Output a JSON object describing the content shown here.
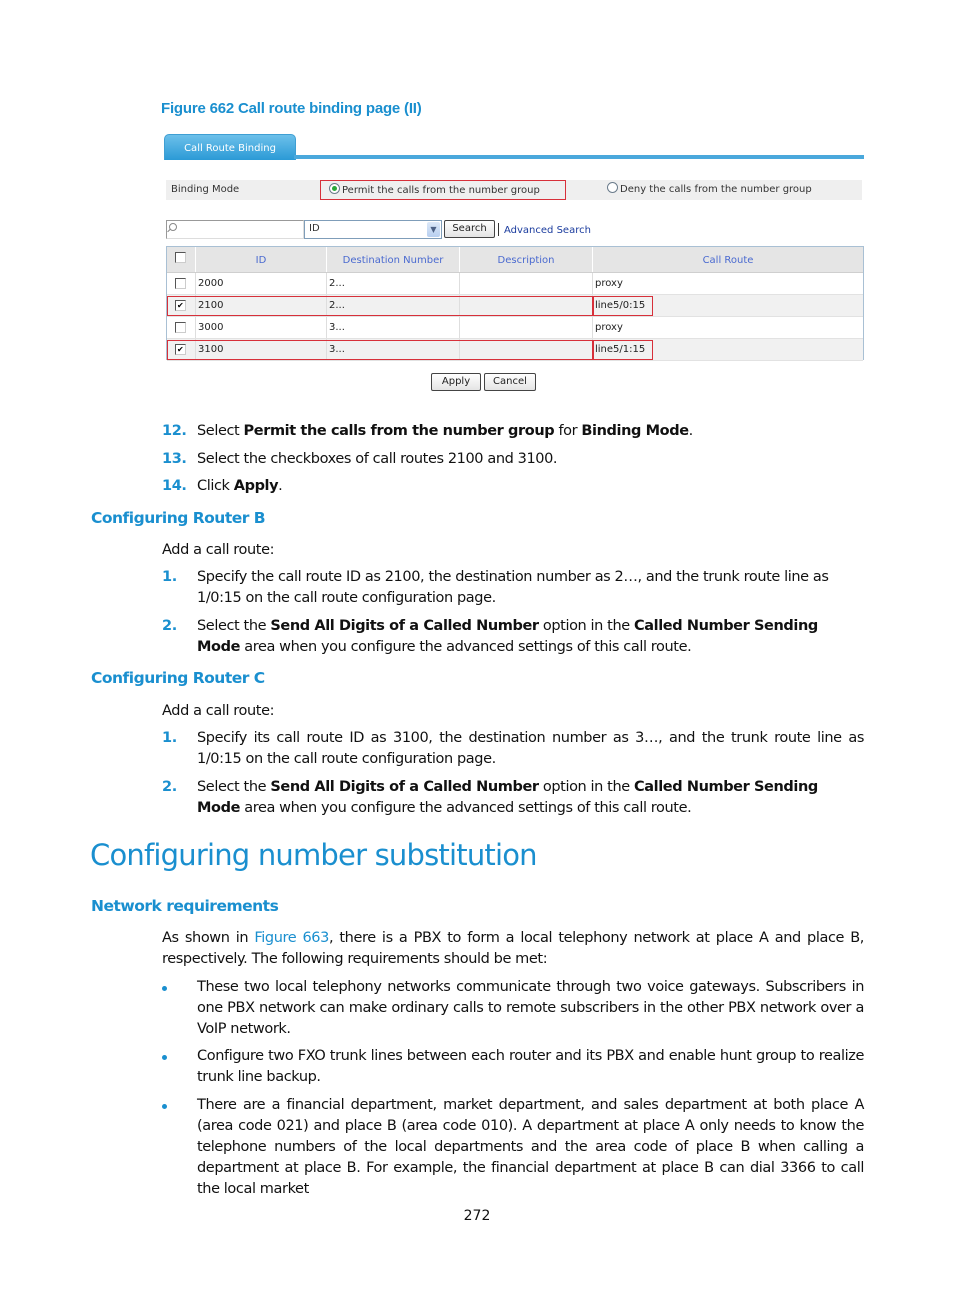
{
  "figure": {
    "caption": "Figure 662 Call route binding page (II)",
    "tab_label": "Call Route Binding",
    "binding_mode": {
      "label": "Binding Mode",
      "options": [
        {
          "label": "Permit the calls from the number group",
          "selected": true
        },
        {
          "label": "Deny the calls from the number group",
          "selected": false
        }
      ]
    },
    "search": {
      "input_value": "",
      "field_select_value": "ID",
      "search_button": "Search",
      "advanced_search_link": "Advanced Search"
    },
    "table": {
      "columns": [
        "ID",
        "Destination Number",
        "Description",
        "Call Route"
      ],
      "rows": [
        {
          "checked": false,
          "id": "2000",
          "destination": "2...",
          "description": "",
          "call_route": "proxy"
        },
        {
          "checked": true,
          "id": "2100",
          "destination": "2...",
          "description": "",
          "call_route": "line5/0:15"
        },
        {
          "checked": false,
          "id": "3000",
          "destination": "3...",
          "description": "",
          "call_route": "proxy"
        },
        {
          "checked": true,
          "id": "3100",
          "destination": "3...",
          "description": "",
          "call_route": "line5/1:15"
        }
      ]
    },
    "apply_button": "Apply",
    "cancel_button": "Cancel"
  },
  "steps_top": [
    {
      "num": "12.",
      "parts": [
        "Select ",
        "Permit the calls from the number group",
        " for ",
        "Binding Mode",
        "."
      ]
    },
    {
      "num": "13.",
      "text": "Select the checkboxes of call routes 2100 and 3100."
    },
    {
      "num": "14.",
      "parts": [
        "Click ",
        "Apply",
        "."
      ]
    }
  ],
  "router_b": {
    "heading": "Configuring Router B",
    "intro": "Add a call route:",
    "steps": [
      {
        "num": "1.",
        "text": "Specify the call route ID as 2100, the destination number as 2…, and the trunk route line as 1/0:15 on the call route configuration page."
      },
      {
        "num": "2.",
        "parts": [
          "Select the ",
          "Send All Digits of a Called Number",
          " option in the ",
          "Called Number Sending Mode",
          " area when you configure the advanced settings of this call route."
        ]
      }
    ]
  },
  "router_c": {
    "heading": "Configuring Router C",
    "intro": "Add a call route:",
    "steps": [
      {
        "num": "1.",
        "text": "Specify its call route ID as 3100, the destination number as 3…, and the trunk route line as 1/0:15 on the call route configuration page."
      },
      {
        "num": "2.",
        "parts": [
          "Select the ",
          "Send All Digits of a Called Number",
          " option in the ",
          "Called Number Sending Mode",
          " area when you configure the advanced settings of this call route."
        ]
      }
    ]
  },
  "section": {
    "title": "Configuring number substitution",
    "subheading": "Network requirements",
    "intro_parts": [
      "As shown in ",
      "Figure 663",
      ", there is a PBX to form a local telephony network at place A and place B, respectively. The following requirements should be met:"
    ],
    "bullets": [
      "These two local telephony networks communicate through two voice gateways. Subscribers in one PBX network can make ordinary calls to remote subscribers in the other PBX network over a VoIP network.",
      "Configure two FXO trunk lines between each router and its PBX and enable hunt group to realize trunk line backup.",
      "There are a financial department, market department, and sales department at both place A (area code 021) and place B (area code 010). A department at place A only needs to know the telephone numbers of the local departments and the area code of place B when calling a department at place B. For example, the financial department at place B can dial 3366 to call the local market"
    ]
  },
  "page_number": "272",
  "colors": {
    "accent": "#1a8fcf",
    "highlight_box": "#d7303a",
    "tab": "#2b9ad6",
    "table_header_text": "#4a6ad0",
    "link_dark": "#1b3c9e"
  }
}
